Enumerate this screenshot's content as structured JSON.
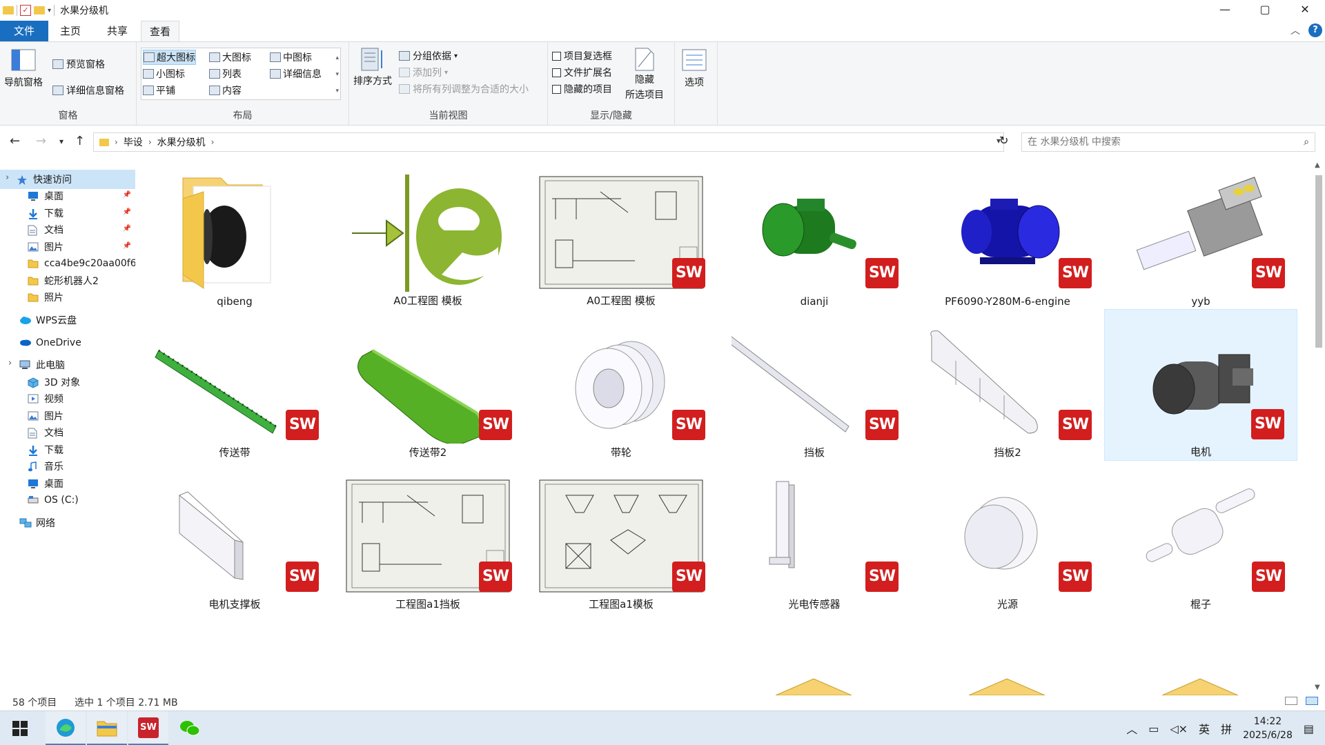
{
  "window": {
    "title": "水果分级机",
    "controls": {
      "minimize": "—",
      "maximize": "▢",
      "close": "✕"
    }
  },
  "tabs": [
    {
      "label": "文件"
    },
    {
      "label": "主页"
    },
    {
      "label": "共享"
    },
    {
      "label": "查看"
    }
  ],
  "ribbon": {
    "panes": {
      "title": "窗格",
      "nav_pane": "导航窗格",
      "preview_pane": "预览窗格",
      "details_pane": "详细信息窗格"
    },
    "layout": {
      "title": "布局",
      "items": [
        "超大图标",
        "大图标",
        "中图标",
        "小图标",
        "列表",
        "详细信息",
        "平铺",
        "内容"
      ],
      "selected": "超大图标"
    },
    "current_view": {
      "title": "当前视图",
      "sort_by": "排序方式",
      "group_by": "分组依据",
      "add_columns": "添加列",
      "size_all_columns": "将所有列调整为合适的大小"
    },
    "show_hide": {
      "title": "显示/隐藏",
      "item_checkboxes": "项目复选框",
      "file_extensions": "文件扩展名",
      "hidden_items": "隐藏的项目",
      "hide_selected_line1": "隐藏",
      "hide_selected_line2": "所选项目"
    },
    "options": "选项"
  },
  "address": {
    "breadcrumb": [
      "毕设",
      "水果分级机"
    ],
    "search_placeholder": "在 水果分级机 中搜索"
  },
  "sidebar": {
    "items": [
      {
        "label": "快速访问",
        "icon": "star-icon"
      },
      {
        "label": "桌面",
        "icon": "desktop-icon",
        "pinned": true
      },
      {
        "label": "下载",
        "icon": "download-icon",
        "pinned": true
      },
      {
        "label": "文档",
        "icon": "document-icon",
        "pinned": true
      },
      {
        "label": "图片",
        "icon": "picture-icon",
        "pinned": true
      },
      {
        "label": "cca4be9c20aa00f6",
        "icon": "folder-icon"
      },
      {
        "label": "蛇形机器人2",
        "icon": "folder-icon"
      },
      {
        "label": "照片",
        "icon": "folder-icon"
      },
      {
        "label": "WPS云盘",
        "icon": "cloud-icon"
      },
      {
        "label": "OneDrive",
        "icon": "onedrive-icon"
      },
      {
        "label": "此电脑",
        "icon": "computer-icon"
      },
      {
        "label": "3D 对象",
        "icon": "cube-icon"
      },
      {
        "label": "视频",
        "icon": "video-icon"
      },
      {
        "label": "图片",
        "icon": "picture-icon"
      },
      {
        "label": "文档",
        "icon": "document-icon"
      },
      {
        "label": "下载",
        "icon": "download-icon"
      },
      {
        "label": "音乐",
        "icon": "music-icon"
      },
      {
        "label": "桌面",
        "icon": "desktop-icon"
      },
      {
        "label": "OS (C:)",
        "icon": "drive-icon"
      },
      {
        "label": "网络",
        "icon": "network-icon"
      }
    ]
  },
  "files": [
    {
      "name": "qibeng",
      "kind": "folder"
    },
    {
      "name": "A0工程图 模板",
      "kind": "easm"
    },
    {
      "name": "A0工程图 模板",
      "kind": "drawing"
    },
    {
      "name": "dianji",
      "kind": "motor-green"
    },
    {
      "name": "PF6090-Y280M-6-engine",
      "kind": "motor-blue"
    },
    {
      "name": "yyb",
      "kind": "hydraulic"
    },
    {
      "name": "传送带",
      "kind": "conveyor-chain"
    },
    {
      "name": "传送带2",
      "kind": "conveyor-belt"
    },
    {
      "name": "带轮",
      "kind": "pulley"
    },
    {
      "name": "挡板",
      "kind": "rod"
    },
    {
      "name": "挡板2",
      "kind": "baffle"
    },
    {
      "name": "电机",
      "kind": "motor-gray",
      "selected": true
    },
    {
      "name": "电机支撑板",
      "kind": "plate"
    },
    {
      "name": "工程图a1挡板",
      "kind": "drawing"
    },
    {
      "name": "工程图a1模板",
      "kind": "drawing2"
    },
    {
      "name": "光电传感器",
      "kind": "sensor"
    },
    {
      "name": "光源",
      "kind": "lamp"
    },
    {
      "name": "棍子",
      "kind": "roller"
    }
  ],
  "sw_badge": "SW",
  "status": {
    "count": "58 个项目",
    "selection": "选中 1 个项目  2.71 MB"
  },
  "taskbar": {
    "ime_lang": "英",
    "ime_mode": "拼",
    "time": "14:22",
    "date": "2025/6/28"
  },
  "colors": {
    "accent": "#1a6ec0",
    "selection": "#cce4f7",
    "sw_red": "#d21e1e"
  }
}
